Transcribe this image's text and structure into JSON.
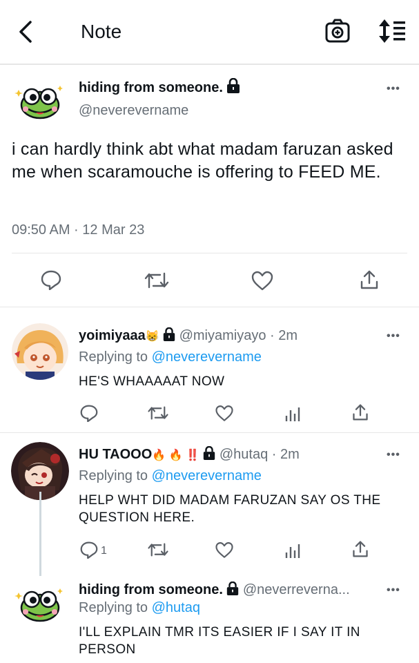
{
  "header": {
    "title": "Note"
  },
  "main_tweet": {
    "name": "hiding from someone.",
    "handle": "@neverevername",
    "text": "i can hardly think abt what madam faruzan asked me when scaramouche is offering to FEED ME.",
    "timestamp": "09:50 AM · 12 Mar 23"
  },
  "replies": [
    {
      "name": "yoimiyaaa",
      "emoji": "😸",
      "handle": "@miyamiyayo · 2m",
      "replying_prefix": "Replying to",
      "replying_to": "@neverevername",
      "text": "HE'S WHAAAAAT NOW",
      "reply_count": ""
    },
    {
      "name": "HU TAOOO",
      "emoji": "🔥 🔥 ‼️",
      "handle": "@hutaq · 2m",
      "replying_prefix": "Replying to",
      "replying_to": "@neverevername",
      "text": "HELP WHT DID MADAM FARUZAN SAY OS THE QUESTION HERE.",
      "reply_count": "1"
    },
    {
      "name": "hiding from someone.",
      "handle": "@neverreverna...",
      "replying_prefix": "Replying to",
      "replying_to": "@hutaq",
      "text": "I'LL EXPLAIN TMR ITS EASIER IF I SAY IT IN PERSON"
    }
  ],
  "icons": [
    "back-icon",
    "camera-icon",
    "sort-icon",
    "lock-icon",
    "more-icon",
    "reply-icon",
    "retweet-icon",
    "like-icon",
    "share-icon",
    "analytics-icon"
  ],
  "colors": {
    "link": "#1d9bf0",
    "muted": "#666e76",
    "divider": "#e6e6e6"
  }
}
